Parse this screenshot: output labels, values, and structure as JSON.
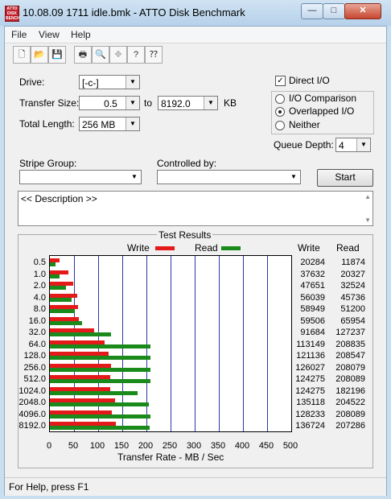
{
  "window": {
    "title": "10.08.09  1711 idle.bmk - ATTO Disk Benchmark",
    "icon_text": "ATTO DISK BENCH",
    "min": "—",
    "max": "□",
    "close": "✕"
  },
  "menu": [
    "File",
    "View",
    "Help"
  ],
  "toolbar": {
    "icons": [
      "new-icon",
      "open-icon",
      "save-icon",
      "print-icon",
      "print-preview-icon",
      "move-icon",
      "help-icon",
      "context-help-icon"
    ]
  },
  "form": {
    "drive_label": "Drive:",
    "drive_value": "[-c-]",
    "transfer_label": "Transfer Size:",
    "transfer_from": "0.5",
    "to_label": "to",
    "transfer_to": "8192.0",
    "kb_label": "KB",
    "length_label": "Total Length:",
    "length_value": "256 MB",
    "direct_io_label": "Direct I/O",
    "direct_io_checked": true,
    "io_comparison": "I/O Comparison",
    "overlapped_io": "Overlapped I/O",
    "neither": "Neither",
    "selected_mode": "overlapped",
    "queue_label": "Queue Depth:",
    "queue_value": "4",
    "stripe_label": "Stripe Group:",
    "controlled_label": "Controlled by:",
    "start_label": "Start",
    "description": "<< Description >>"
  },
  "results": {
    "legend_title": "Test Results",
    "write_label": "Write",
    "read_label": "Read",
    "col_write": "Write",
    "col_read": "Read",
    "xlabel": "Transfer Rate - MB / Sec",
    "colors": {
      "write": "#e41a1a",
      "read": "#1a8a1a",
      "grid": "#2b36a8"
    }
  },
  "chart_data": {
    "type": "bar",
    "categories": [
      "0.5",
      "1.0",
      "2.0",
      "4.0",
      "8.0",
      "16.0",
      "32.0",
      "64.0",
      "128.0",
      "256.0",
      "512.0",
      "1024.0",
      "2048.0",
      "4096.0",
      "8192.0"
    ],
    "series": [
      {
        "name": "Write",
        "values": [
          20284,
          37632,
          47651,
          56039,
          58949,
          59506,
          91684,
          113149,
          121136,
          126027,
          124275,
          124275,
          135118,
          128233,
          136724
        ]
      },
      {
        "name": "Read",
        "values": [
          11874,
          20327,
          32524,
          45736,
          51200,
          65954,
          127237,
          208835,
          208547,
          208079,
          208089,
          182196,
          204522,
          208089,
          207286
        ]
      }
    ],
    "xlabel": "Transfer Rate - MB / Sec",
    "xlim": [
      0,
      500
    ],
    "xticks": [
      "0",
      "50",
      "100",
      "150",
      "200",
      "250",
      "300",
      "350",
      "400",
      "450",
      "500"
    ],
    "grid": true,
    "legend": "top"
  },
  "status": "For Help, press F1"
}
